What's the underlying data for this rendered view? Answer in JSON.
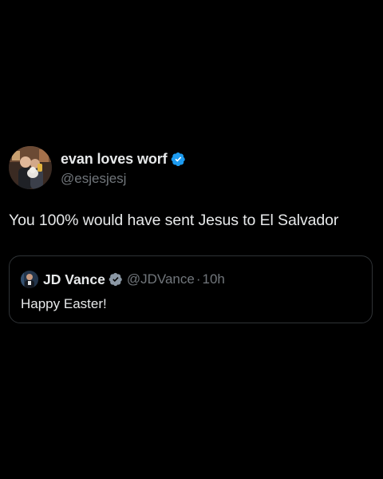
{
  "tweet": {
    "author": {
      "display_name": "evan loves worf",
      "handle": "@esjesjesj",
      "verified": true,
      "avatar_icon": "profile-photo"
    },
    "text": "You 100% would have sent Jesus to El Salvador",
    "quoted_tweet": {
      "author": {
        "display_name": "JD Vance",
        "handle": "@JDVance",
        "verified": true,
        "avatar_icon": "profile-photo"
      },
      "separator": "·",
      "time": "10h",
      "text": "Happy Easter!"
    }
  },
  "colors": {
    "background": "#000000",
    "primary_text": "#e7e9ea",
    "secondary_text": "#71767b",
    "verified_blue": "#1d9bf0",
    "verified_gray": "#8b98a5",
    "border": "#2f3336"
  }
}
